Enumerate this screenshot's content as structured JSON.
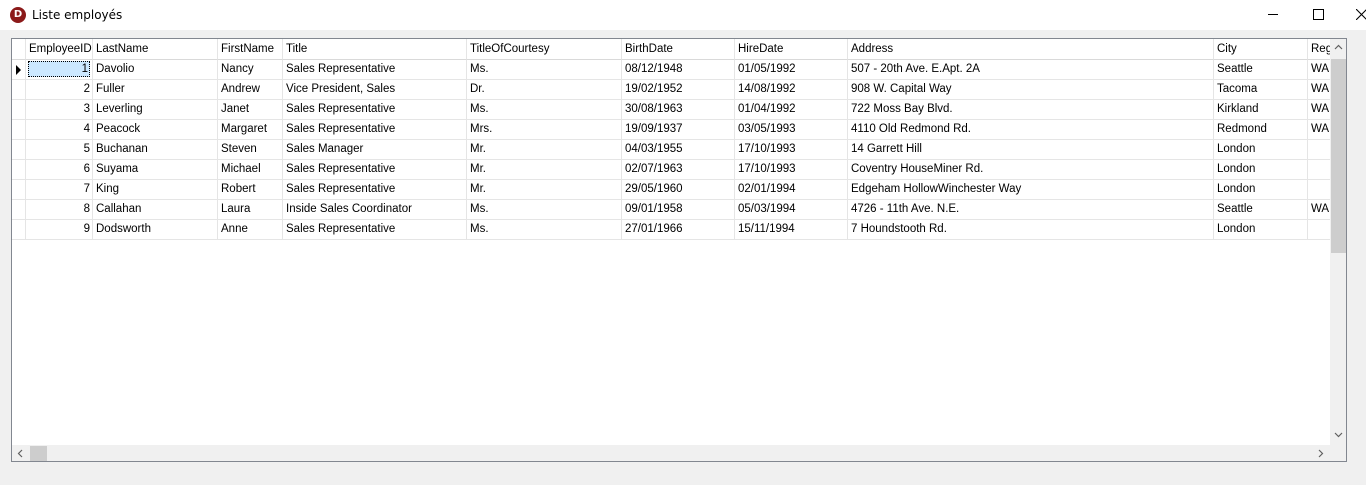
{
  "window": {
    "title": "Liste employés",
    "app_icon_letter": "D"
  },
  "grid": {
    "columns": [
      "EmployeeID",
      "LastName",
      "FirstName",
      "Title",
      "TitleOfCourtesy",
      "BirthDate",
      "HireDate",
      "Address",
      "City",
      "Reg"
    ],
    "rows": [
      [
        "1",
        "Davolio",
        "Nancy",
        "Sales Representative",
        "Ms.",
        "08/12/1948",
        "01/05/1992",
        "507 - 20th Ave. E.Apt. 2A",
        "Seattle",
        "WA"
      ],
      [
        "2",
        "Fuller",
        "Andrew",
        "Vice President, Sales",
        "Dr.",
        "19/02/1952",
        "14/08/1992",
        "908 W. Capital Way",
        "Tacoma",
        "WA"
      ],
      [
        "3",
        "Leverling",
        "Janet",
        "Sales Representative",
        "Ms.",
        "30/08/1963",
        "01/04/1992",
        "722 Moss Bay Blvd.",
        "Kirkland",
        "WA"
      ],
      [
        "4",
        "Peacock",
        "Margaret",
        "Sales Representative",
        "Mrs.",
        "19/09/1937",
        "03/05/1993",
        "4110 Old Redmond Rd.",
        "Redmond",
        "WA"
      ],
      [
        "5",
        "Buchanan",
        "Steven",
        "Sales Manager",
        "Mr.",
        "04/03/1955",
        "17/10/1993",
        "14 Garrett Hill",
        "London",
        ""
      ],
      [
        "6",
        "Suyama",
        "Michael",
        "Sales Representative",
        "Mr.",
        "02/07/1963",
        "17/10/1993",
        "Coventry HouseMiner Rd.",
        "London",
        ""
      ],
      [
        "7",
        "King",
        "Robert",
        "Sales Representative",
        "Mr.",
        "29/05/1960",
        "02/01/1994",
        "Edgeham HollowWinchester Way",
        "London",
        ""
      ],
      [
        "8",
        "Callahan",
        "Laura",
        "Inside Sales Coordinator",
        "Ms.",
        "09/01/1958",
        "05/03/1994",
        "4726 - 11th Ave. N.E.",
        "Seattle",
        "WA"
      ],
      [
        "9",
        "Dodsworth",
        "Anne",
        "Sales Representative",
        "Ms.",
        "27/01/1966",
        "15/11/1994",
        "7 Houndstooth Rd.",
        "London",
        ""
      ]
    ],
    "selected_row": 0
  },
  "colors": {
    "selection": "#cce8ff",
    "app_icon": "#8b1a1a",
    "grid_line": "#e5e5e5"
  }
}
